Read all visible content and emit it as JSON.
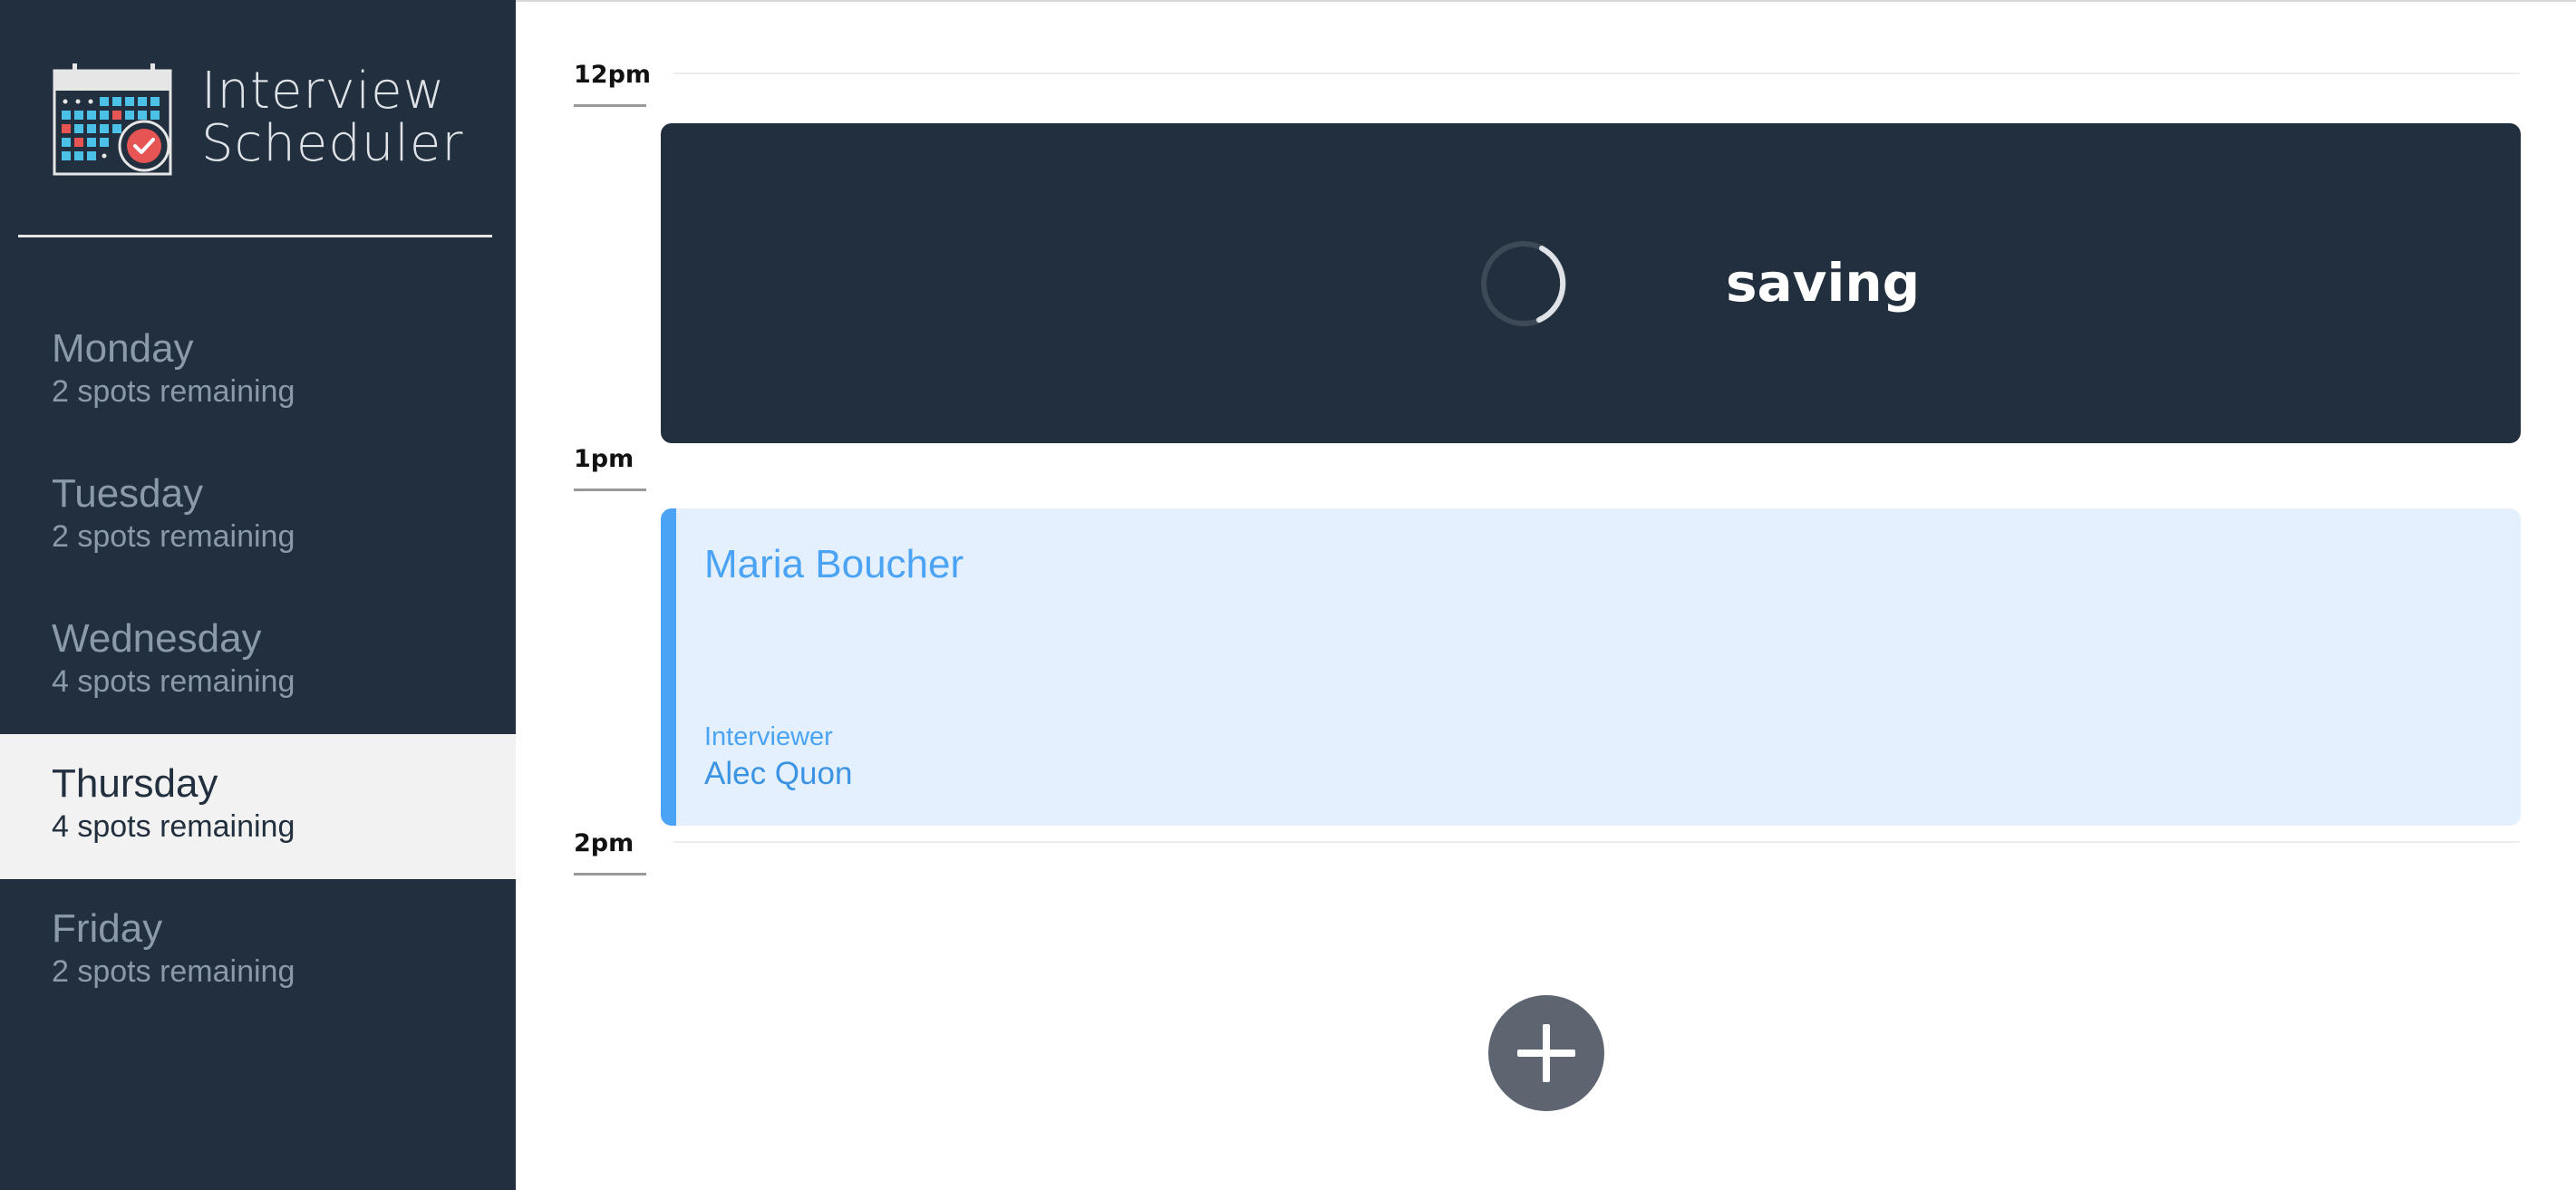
{
  "app": {
    "title_line1": "Interview",
    "title_line2": "Scheduler",
    "logo_icon": "calendar-check-icon"
  },
  "sidebar": {
    "days": [
      {
        "name": "Monday",
        "spots": "2 spots remaining",
        "selected": false
      },
      {
        "name": "Tuesday",
        "spots": "2 spots remaining",
        "selected": false
      },
      {
        "name": "Wednesday",
        "spots": "4 spots remaining",
        "selected": false
      },
      {
        "name": "Thursday",
        "spots": "4 spots remaining",
        "selected": true
      },
      {
        "name": "Friday",
        "spots": "2 spots remaining",
        "selected": false
      }
    ]
  },
  "schedule": {
    "times": [
      "12pm",
      "1pm",
      "2pm"
    ],
    "saving": {
      "label": "saving"
    },
    "appointment": {
      "student": "Maria Boucher",
      "interviewer_label": "Interviewer",
      "interviewer": "Alec Quon"
    },
    "add_button_icon": "plus-icon"
  },
  "colors": {
    "sidebar_bg": "#222f3e",
    "selected_day_bg": "#f2f2f2",
    "appointment_accent": "#4aa3f4",
    "appointment_bg": "#e4f0fd",
    "add_button_bg": "#5d6670"
  }
}
